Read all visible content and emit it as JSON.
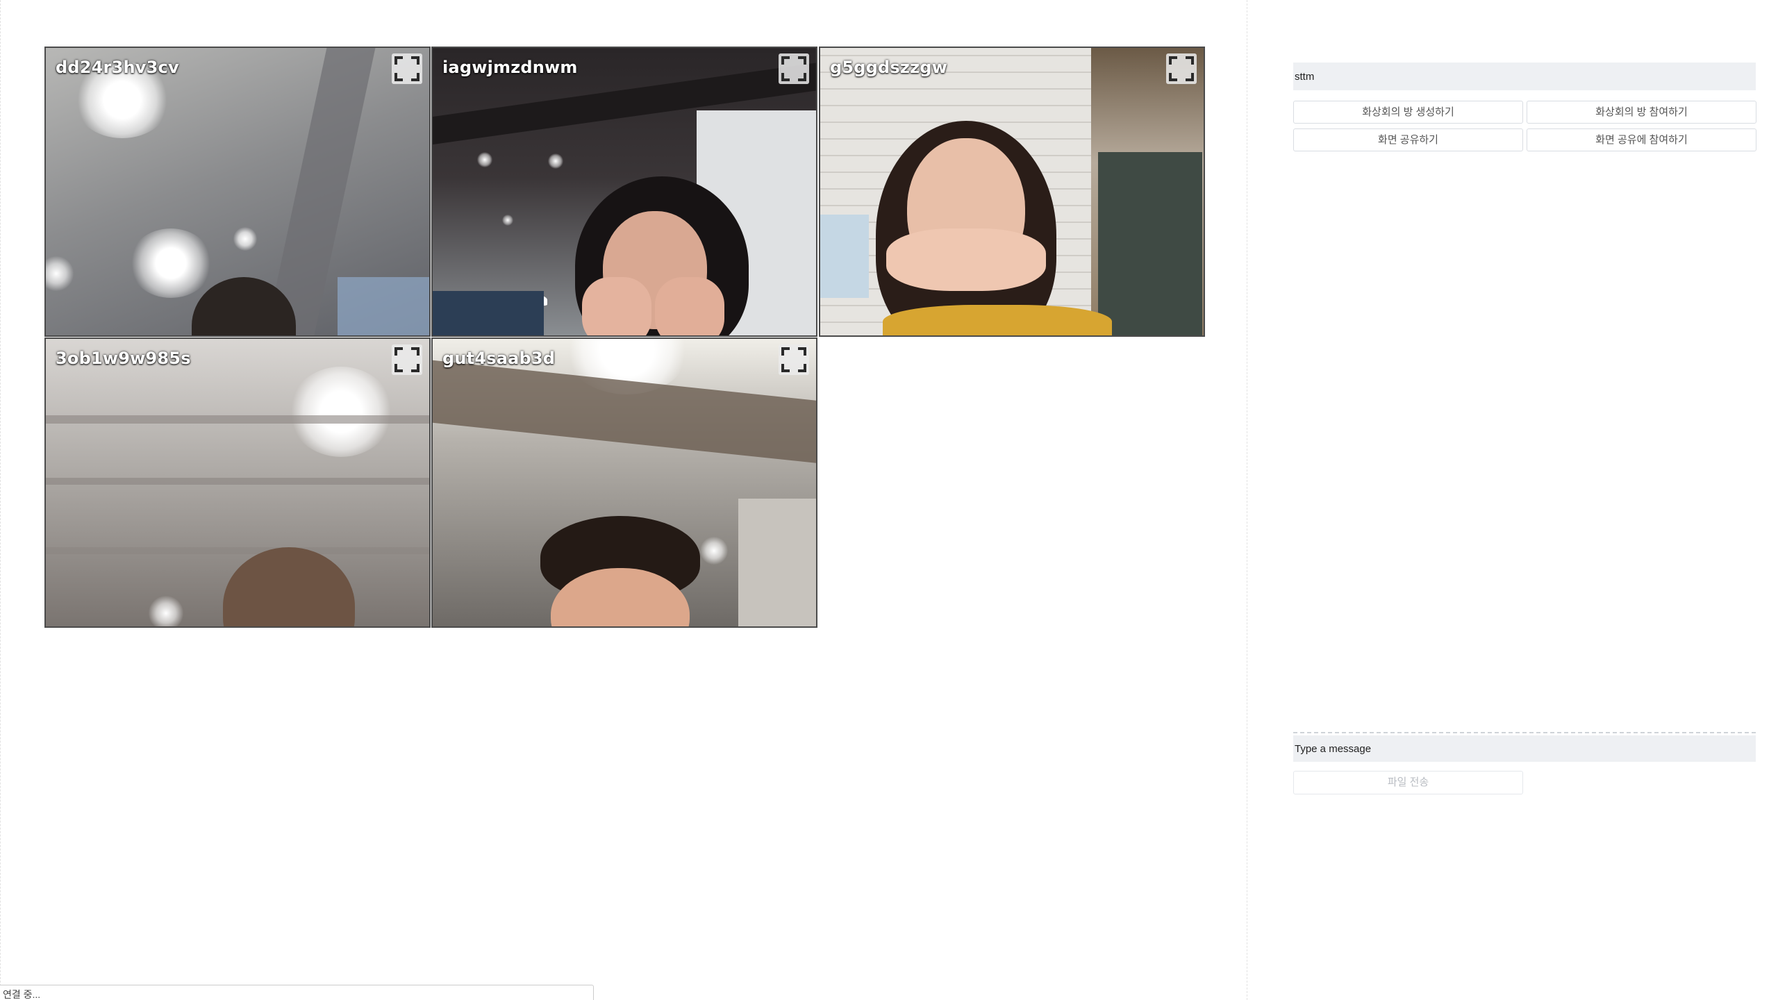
{
  "videos": [
    {
      "username": "dd24r3hv3cv"
    },
    {
      "username": "iagwjmzdnwm"
    },
    {
      "username": "g5ggdszzgw"
    },
    {
      "username": "3ob1w9w985s"
    },
    {
      "username": "gut4saab3d"
    }
  ],
  "panel": {
    "room_name": "sttm",
    "buttons": {
      "create_room": "화상회의 방 생성하기",
      "join_room": "화상회의 방 참여하기",
      "share_screen": "화면 공유하기",
      "join_screen_share": "화면 공유에 참여하기"
    },
    "chat": {
      "message_placeholder": "Type a message",
      "file_send": "파일 전송"
    }
  },
  "status": {
    "connection": "연결 중..."
  },
  "icons": {
    "fullscreen": "fullscreen-icon"
  }
}
